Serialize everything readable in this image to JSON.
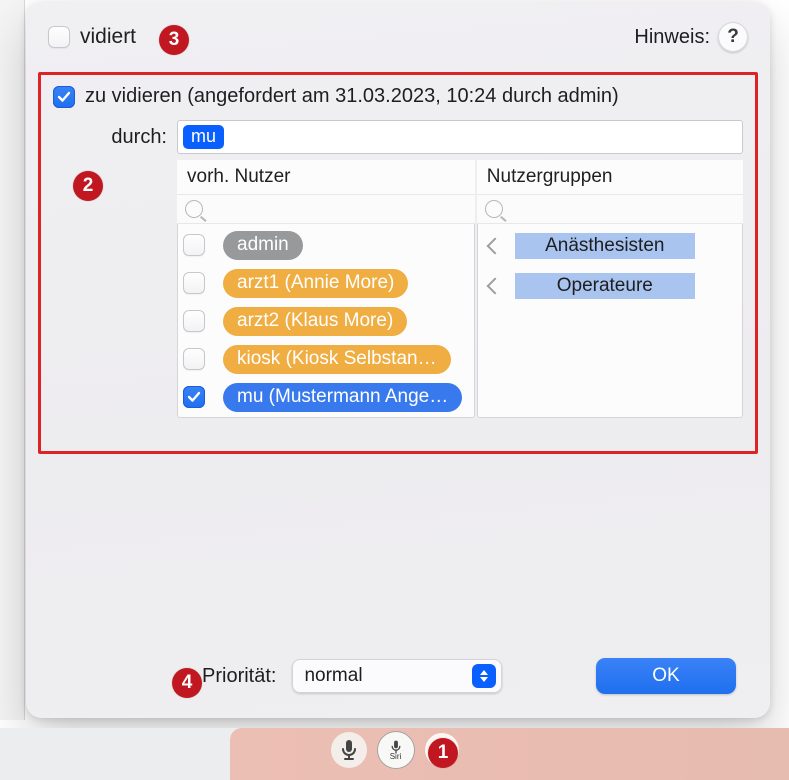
{
  "top": {
    "vidiert_checked": false,
    "vidiert_label": "vidiert",
    "hinweis_label": "Hinweis:",
    "help_symbol": "?"
  },
  "zu_vidieren": {
    "checked": true,
    "label": "zu vidieren (angefordert am 31.03.2023, 10:24 durch admin)",
    "durch_label": "durch:",
    "durch_token": "mu"
  },
  "users_list": {
    "header": "vorh. Nutzer",
    "items": [
      {
        "label": "admin",
        "color": "grey",
        "checked": false
      },
      {
        "label": "arzt1 (Annie More)",
        "color": "orange",
        "checked": false
      },
      {
        "label": "arzt2 (Klaus More)",
        "color": "orange",
        "checked": false
      },
      {
        "label": "kiosk (Kiosk Selbstan…",
        "color": "orange",
        "checked": false
      },
      {
        "label": "mu (Mustermann Ange…",
        "color": "blue",
        "checked": true
      }
    ]
  },
  "groups_list": {
    "header": "Nutzergruppen",
    "items": [
      {
        "label": "Anästhesisten"
      },
      {
        "label": "Operateure"
      }
    ]
  },
  "priority": {
    "label": "Priorität:",
    "value": "normal"
  },
  "ok_label": "OK",
  "bottom": {
    "siri_text": "Siri"
  },
  "annotations": {
    "a1": "1",
    "a2": "2",
    "a3": "3",
    "a4": "4"
  }
}
